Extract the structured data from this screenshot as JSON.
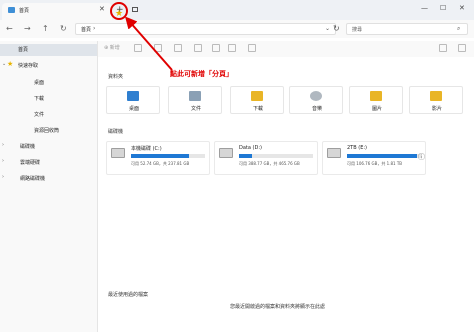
{
  "tab": {
    "title": "首頁",
    "close": "✕",
    "new_tab": "+"
  },
  "window": {
    "minimize": "—",
    "maximize": "☐",
    "close": "✕"
  },
  "nav": {
    "back": "←",
    "forward": "→",
    "up": "↑",
    "refresh": "↻"
  },
  "address": {
    "path": "首頁",
    "chevron": "›",
    "dropdown": "⌄",
    "refresh": "↻"
  },
  "search": {
    "placeholder": "搜尋",
    "icon": "⌕"
  },
  "toolbar": {
    "new_label": "新增"
  },
  "sidebar": {
    "items": [
      {
        "label": "首頁",
        "icon": "home-icon",
        "color": "#3f8fd6"
      },
      {
        "label": "快速存取",
        "icon": "star-icon",
        "color": "#e8b400"
      },
      {
        "label": "桌面",
        "icon": "desktop-icon",
        "color": "#2f7fd0"
      },
      {
        "label": "下載",
        "icon": "download-icon",
        "color": "#2f7fd0"
      },
      {
        "label": "文件",
        "icon": "document-icon",
        "color": "#7a8fa6"
      },
      {
        "label": "資源回收筒",
        "icon": "recycle-bin-icon",
        "color": "#8ca0b3"
      },
      {
        "label": "磁碟機",
        "icon": "drive-icon",
        "color": "#4a6f97"
      },
      {
        "label": "雲端硬碟",
        "icon": "cloud-icon",
        "color": "#5a6a7a"
      },
      {
        "label": "網路磁碟機",
        "icon": "network-drive-icon",
        "color": "#5a6a7a"
      }
    ]
  },
  "folders": {
    "title": "資料夾",
    "items": [
      {
        "label": "桌面",
        "icon": "desktop-folder-icon",
        "color": "#2f7fd0"
      },
      {
        "label": "文件",
        "icon": "documents-folder-icon",
        "color": "#8aa0b5"
      },
      {
        "label": "下載",
        "icon": "downloads-folder-icon",
        "color": "#e9b526"
      },
      {
        "label": "音樂",
        "icon": "music-folder-icon",
        "color": "#b0b8c0"
      },
      {
        "label": "圖片",
        "icon": "pictures-folder-icon",
        "color": "#e9b526"
      },
      {
        "label": "影片",
        "icon": "videos-folder-icon",
        "color": "#e9b526"
      }
    ]
  },
  "drives": {
    "title": "磁碟機",
    "items": [
      {
        "name": "本機磁碟 (C:)",
        "info": "可用 52.74 GB，共 237.81 GB",
        "used_fraction": 0.78
      },
      {
        "name": "Data (D:)",
        "info": "可用 388.77 GB，共 465.76 GB",
        "used_fraction": 0.17
      },
      {
        "name": "2TB (E:)",
        "info": "可用 106.76 GB，共 1.81 TB",
        "used_fraction": 0.94
      }
    ]
  },
  "recent": {
    "title": "最近使用過的檔案",
    "empty_message": "您最近開啟過的檔案和資料夾將顯示在此處"
  },
  "annotation": {
    "text": "點此可新增「分頁」",
    "color": "#e00000"
  }
}
